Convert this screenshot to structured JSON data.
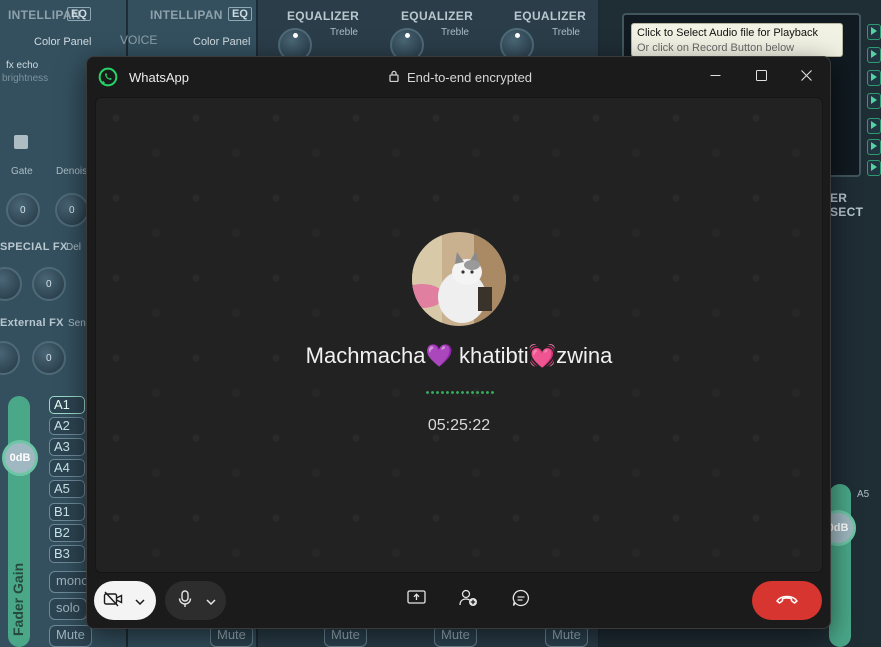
{
  "background": {
    "intellipan_1": "INTELLIPAN",
    "intellipan_2": "INTELLIPAN",
    "eq": "EQ",
    "color_panel": "Color Panel",
    "voice": "VOICE",
    "fx_echo": "fx echo",
    "brightness": "brightness",
    "equalizer": "EQUALIZER",
    "treble": "Treble",
    "gate": "Gate",
    "denoiser": "Denois",
    "special_fx": "SPECIAL FX",
    "delay": "Del",
    "external_fx": "External FX",
    "sen": "Sen",
    "knob_value": "0",
    "fader_db_left": "0dB",
    "fader_db_right": "0dB",
    "fader_gain": "Fader Gain",
    "routing": [
      "A1",
      "A2",
      "A3",
      "A4",
      "A5",
      "B1",
      "B2",
      "B3"
    ],
    "mono": "mono",
    "solo": "solo",
    "mute": "Mute",
    "tooltip_line1": "Click to Select Audio file for Playback",
    "tooltip_line2": "Or click on Record Button below",
    "master_section": "ER SECT",
    "a5": "A5"
  },
  "whatsapp": {
    "app_title": "WhatsApp",
    "encryption": "End-to-end encrypted",
    "contact_name": "Machmacha💜 khatibti💓zwina",
    "call_timer": "05:25:22",
    "icons": {
      "logo": "whatsapp-logo-icon",
      "lock": "lock-icon",
      "minimize": "minimize-icon",
      "maximize": "maximize-icon",
      "close": "close-icon",
      "camera_off": "camera-off-icon",
      "microphone": "microphone-icon",
      "share_screen": "share-screen-icon",
      "add_person": "add-person-icon",
      "chat": "chat-icon",
      "end_call": "end-call-icon"
    },
    "colors": {
      "accent_green": "#25d366",
      "end_call_red": "#d7352f",
      "window_bg": "#1b1b1b"
    }
  }
}
